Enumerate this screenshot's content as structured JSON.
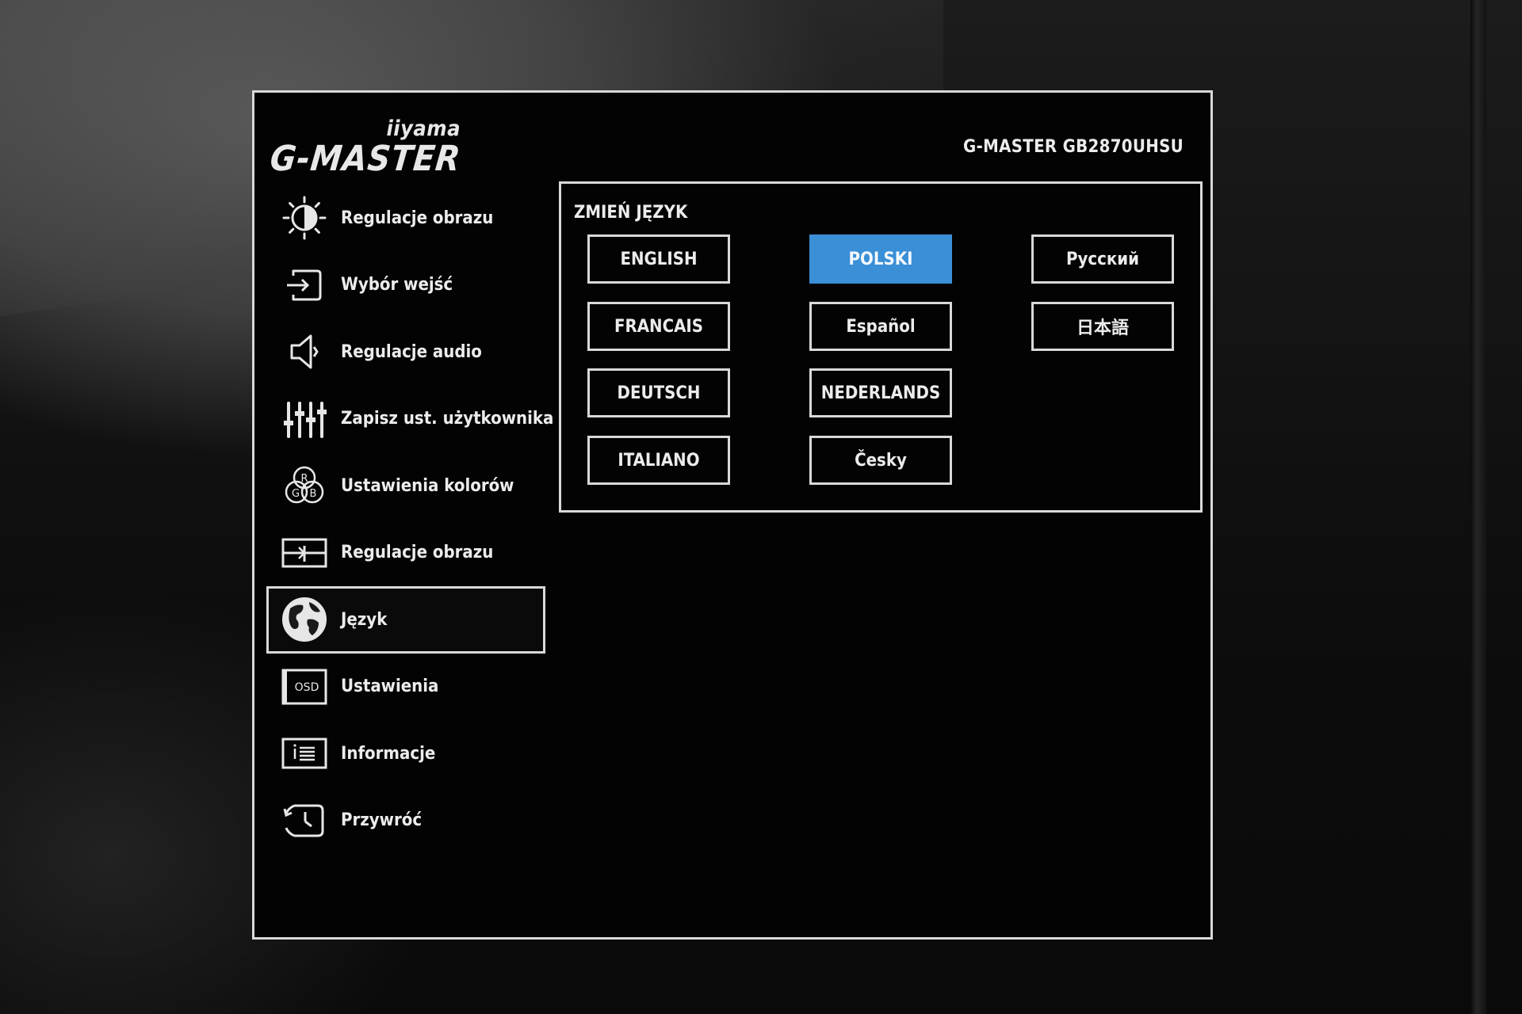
{
  "brand": {
    "sub": "iiyama",
    "main": "G-MASTER"
  },
  "model": "G-MASTER GB2870UHSU",
  "sidebar": {
    "items": [
      {
        "label": "Regulacje obrazu",
        "icon": "brightness-icon"
      },
      {
        "label": "Wybór wejść",
        "icon": "input-select-icon"
      },
      {
        "label": "Regulacje audio",
        "icon": "speaker-icon"
      },
      {
        "label": "Zapisz ust. użytkownika",
        "icon": "sliders-icon"
      },
      {
        "label": "Ustawienia kolorów",
        "icon": "rgb-icon"
      },
      {
        "label": "Regulacje obrazu",
        "icon": "image-adjust-icon"
      },
      {
        "label": "Język",
        "icon": "globe-icon",
        "active": true
      },
      {
        "label": "Ustawienia",
        "icon": "osd-icon"
      },
      {
        "label": "Informacje",
        "icon": "info-icon"
      },
      {
        "label": "Przywróć",
        "icon": "reset-clock-icon"
      }
    ]
  },
  "language_panel": {
    "title": "ZMIEŃ JĘZYK",
    "languages": [
      {
        "label": "ENGLISH"
      },
      {
        "label": "POLSKI",
        "selected": true
      },
      {
        "label": "Русский"
      },
      {
        "label": "FRANCAIS"
      },
      {
        "label": "Español"
      },
      {
        "label": "日本語"
      },
      {
        "label": "DEUTSCH"
      },
      {
        "label": "NEDERLANDS"
      },
      {
        "label": "ITALIANO"
      },
      {
        "label": "Česky"
      }
    ]
  },
  "colors": {
    "selected": "#3a8fd6",
    "border": "#d9d9d9",
    "text": "#ececec",
    "background": "#030303"
  },
  "osd_label": "OSD",
  "rgb_letters": {
    "r": "R",
    "g": "G",
    "b": "B"
  }
}
